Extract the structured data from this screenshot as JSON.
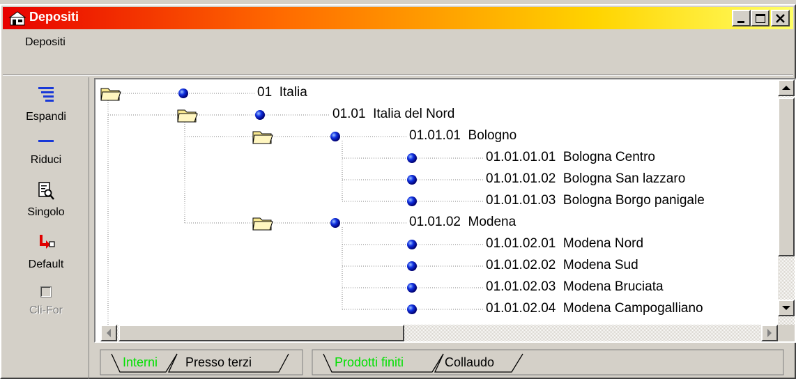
{
  "window": {
    "title": "Depositi",
    "controls": {
      "minimize": "_",
      "maximize": "□",
      "close": "×"
    }
  },
  "menu": {
    "items": [
      {
        "label": "Depositi"
      }
    ]
  },
  "toolbar": {
    "items": [
      {
        "label": "Espandi",
        "icon": "expand-lines-icon",
        "enabled": true
      },
      {
        "label": "Riduci",
        "icon": "collapse-line-icon",
        "enabled": true
      },
      {
        "label": "Singolo",
        "icon": "document-magnifier-icon",
        "enabled": true
      },
      {
        "label": "Default",
        "icon": "default-arrow-icon",
        "enabled": true
      },
      {
        "label": "Cli-For",
        "icon": "checkbox-icon",
        "enabled": false,
        "checked": false
      }
    ]
  },
  "tree": {
    "nodes": [
      {
        "code": "01",
        "name": "Italia",
        "level": 0,
        "has_folder": true
      },
      {
        "code": "01.01",
        "name": "Italia del Nord",
        "level": 1,
        "has_folder": true
      },
      {
        "code": "01.01.01",
        "name": "Bologno",
        "level": 2,
        "has_folder": true
      },
      {
        "code": "01.01.01.01",
        "name": "Bologna Centro",
        "level": 3,
        "has_folder": false
      },
      {
        "code": "01.01.01.02",
        "name": "Bologna San lazzaro",
        "level": 3,
        "has_folder": false
      },
      {
        "code": "01.01.01.03",
        "name": "Bologna Borgo panigale",
        "level": 3,
        "has_folder": false
      },
      {
        "code": "01.01.02",
        "name": "Modena",
        "level": 2,
        "has_folder": true
      },
      {
        "code": "01.01.02.01",
        "name": "Modena Nord",
        "level": 3,
        "has_folder": false
      },
      {
        "code": "01.01.02.02",
        "name": "Modena Sud",
        "level": 3,
        "has_folder": false
      },
      {
        "code": "01.01.02.03",
        "name": "Modena Bruciata",
        "level": 3,
        "has_folder": false
      },
      {
        "code": "01.01.02.04",
        "name": "Modena Campogalliano",
        "level": 3,
        "has_folder": false
      }
    ]
  },
  "tabs": {
    "group1": [
      {
        "label": "Interni",
        "active": true
      },
      {
        "label": "Presso terzi",
        "active": false
      }
    ],
    "group2": [
      {
        "label": "Prodotti finiti",
        "active": true
      },
      {
        "label": "Collaudo",
        "active": false
      }
    ]
  },
  "colors": {
    "title_gradient_start": "#e80000",
    "title_gradient_end": "#ffff66",
    "active_tab_text": "#00e000",
    "node_ball": "#1030e0"
  }
}
